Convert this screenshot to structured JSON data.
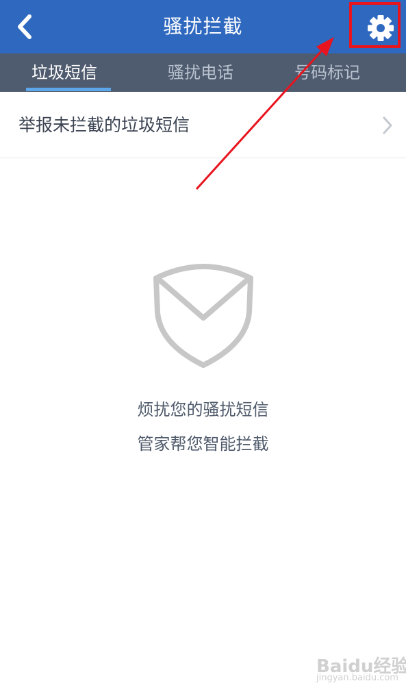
{
  "header": {
    "title": "骚扰拦截",
    "back_icon": "chevron-left-icon",
    "settings_icon": "gear-icon"
  },
  "tabs": [
    {
      "label": "垃圾短信",
      "active": true
    },
    {
      "label": "骚扰电话",
      "active": false
    },
    {
      "label": "号码标记",
      "active": false
    }
  ],
  "report": {
    "label": "举报未拦截的垃圾短信",
    "chevron_icon": "chevron-right-icon"
  },
  "empty_state": {
    "icon": "shield-envelope-icon",
    "line1": "烦扰您的骚扰短信",
    "line2": "管家帮您智能拦截"
  },
  "annotation": {
    "arrow_color": "#e8141e",
    "box_color": "#e8141e"
  },
  "watermark": {
    "logo": "Baidu经验",
    "url": "jingyan.baidu.com"
  },
  "colors": {
    "header_bg": "#2f68bf",
    "tab_bar_bg": "#4f5b6e",
    "tab_indicator": "#5ba7ea"
  }
}
